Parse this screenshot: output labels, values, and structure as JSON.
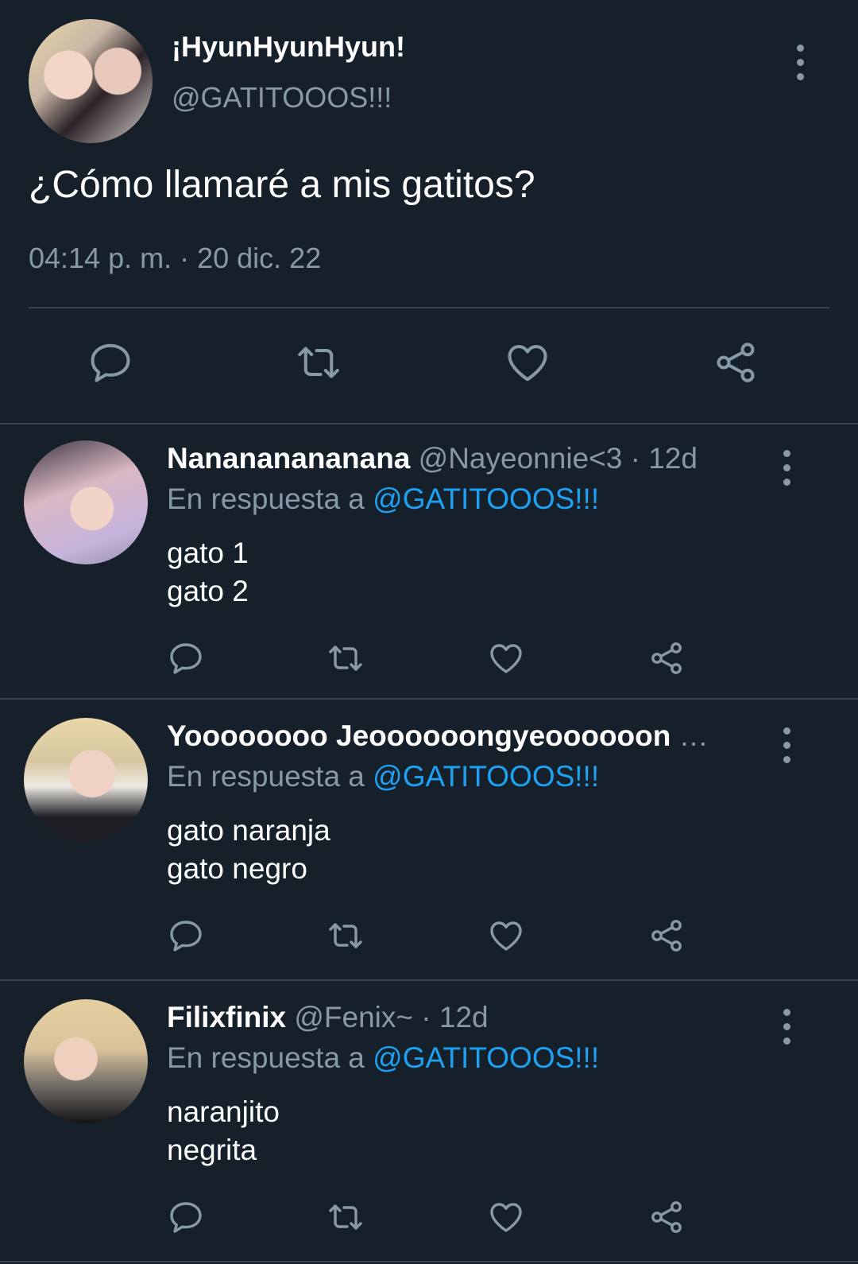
{
  "main_tweet": {
    "display_name": "¡HyunHyunHyun!",
    "handle": "@GATITOOOS!!!",
    "text": "¿Cómo llamaré a mis gatitos?",
    "timestamp": "04:14 p. m. · 20 dic. 22",
    "actions": [
      "reply-icon",
      "retweet-icon",
      "like-icon",
      "share-icon"
    ]
  },
  "replies": [
    {
      "display_name": "Nanananananana",
      "handle": "@Nayeonnie<3",
      "age": "· 12d",
      "in_reply_prefix": "En respuesta a",
      "in_reply_to": "@GATITOOOS!!!",
      "line1": "gato 1",
      "line2": "gato 2"
    },
    {
      "display_name": "Yoooooooo Jeoooooongyeoooooon",
      "handle": "…",
      "age": "",
      "in_reply_prefix": "En respuesta a",
      "in_reply_to": "@GATITOOOS!!!",
      "line1": "gato naranja",
      "line2": "gato negro"
    },
    {
      "display_name": "Filixfinix",
      "handle": "@Fenix~",
      "age": "· 12d",
      "in_reply_prefix": "En respuesta a",
      "in_reply_to": "@GATITOOOS!!!",
      "line1": "naranjito",
      "line2": "negrita"
    }
  ],
  "colors": {
    "background": "#15202b",
    "text": "#ffffff",
    "muted": "#8899a6",
    "link": "#1da1f2",
    "divider": "#38444d"
  }
}
